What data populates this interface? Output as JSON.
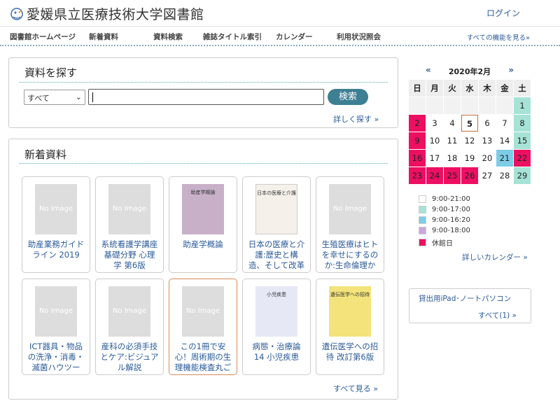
{
  "header": {
    "title": "愛媛県立医療技術大学図書館",
    "login": "ログイン"
  },
  "nav": {
    "items": [
      "図書館ホームページ",
      "新着資料",
      "資料検索",
      "雑誌タイトル索引",
      "カレンダー",
      "利用状況照会"
    ],
    "all_features": "すべての機能を見る»"
  },
  "search": {
    "title": "資料を探す",
    "select_value": "すべて",
    "input_value": "",
    "button": "検索",
    "advanced": "詳しく探す »"
  },
  "new_items": {
    "title": "新着資料",
    "no_image": "No Image",
    "books": [
      {
        "title": "助産業務ガイドライン 2019",
        "cover": "none"
      },
      {
        "title": "系統看護学講座 基礎分野 心理学 第6版",
        "cover": "none"
      },
      {
        "title": "助産学概論",
        "cover": "img",
        "cover_text": "助産学概論"
      },
      {
        "title": "日本の医療と介護:歴史と構造、そして改革",
        "cover": "img2",
        "cover_text": "日本の医療と介護"
      },
      {
        "title": "生殖医療はヒトを幸せにするのか:生命倫理か",
        "cover": "none"
      },
      {
        "title": "ICT器具・物品の洗浄・消毒・滅菌ハウツー",
        "cover": "none"
      },
      {
        "title": "産科の必須手技とケア:ビジュアル解説",
        "cover": "none"
      },
      {
        "title": "この1冊で安心！周術期の生理機能検査丸ご",
        "cover": "none"
      },
      {
        "title": "病態・治療論 14 小児疾患",
        "cover": "img3",
        "cover_text": "小児疾患"
      },
      {
        "title": "遺伝医学への招待 改訂第6版",
        "cover": "img4",
        "cover_text": "遺伝医学への招待"
      }
    ],
    "see_all": "すべて見る »"
  },
  "calendar": {
    "prev": "«",
    "next": "»",
    "title": "2020年2月",
    "dow": [
      "日",
      "月",
      "火",
      "水",
      "木",
      "金",
      "土"
    ],
    "weeks": [
      [
        null,
        null,
        null,
        null,
        null,
        null,
        {
          "d": "1",
          "t": "green"
        }
      ],
      [
        {
          "d": "2",
          "t": "closed"
        },
        {
          "d": "3",
          "t": ""
        },
        {
          "d": "4",
          "t": ""
        },
        {
          "d": "5",
          "t": "today"
        },
        {
          "d": "6",
          "t": ""
        },
        {
          "d": "7",
          "t": ""
        },
        {
          "d": "8",
          "t": "green"
        }
      ],
      [
        {
          "d": "9",
          "t": "closed"
        },
        {
          "d": "10",
          "t": ""
        },
        {
          "d": "11",
          "t": ""
        },
        {
          "d": "12",
          "t": ""
        },
        {
          "d": "13",
          "t": ""
        },
        {
          "d": "14",
          "t": ""
        },
        {
          "d": "15",
          "t": "green"
        }
      ],
      [
        {
          "d": "16",
          "t": "closed"
        },
        {
          "d": "17",
          "t": ""
        },
        {
          "d": "18",
          "t": ""
        },
        {
          "d": "19",
          "t": ""
        },
        {
          "d": "20",
          "t": ""
        },
        {
          "d": "21",
          "t": "blue"
        },
        {
          "d": "22",
          "t": "closed"
        }
      ],
      [
        {
          "d": "23",
          "t": "closed"
        },
        {
          "d": "24",
          "t": "closed"
        },
        {
          "d": "25",
          "t": "closed"
        },
        {
          "d": "26",
          "t": "closed"
        },
        {
          "d": "27",
          "t": ""
        },
        {
          "d": "28",
          "t": ""
        },
        {
          "d": "29",
          "t": "green"
        }
      ]
    ],
    "legend": [
      {
        "label": "9:00-21:00",
        "color": "#ffffff"
      },
      {
        "label": "9:00-17:00",
        "color": "#a6e3d6"
      },
      {
        "label": "9:00-16:20",
        "color": "#7dcde6"
      },
      {
        "label": "9:00-18:00",
        "color": "#c9a6dd"
      },
      {
        "label": "休館日",
        "color": "#ec0f62"
      }
    ],
    "detail_link": "詳しいカレンダー »"
  },
  "lending": {
    "title": "貸出用iPad･ノートパソコン",
    "all": "すべて(1) »"
  }
}
